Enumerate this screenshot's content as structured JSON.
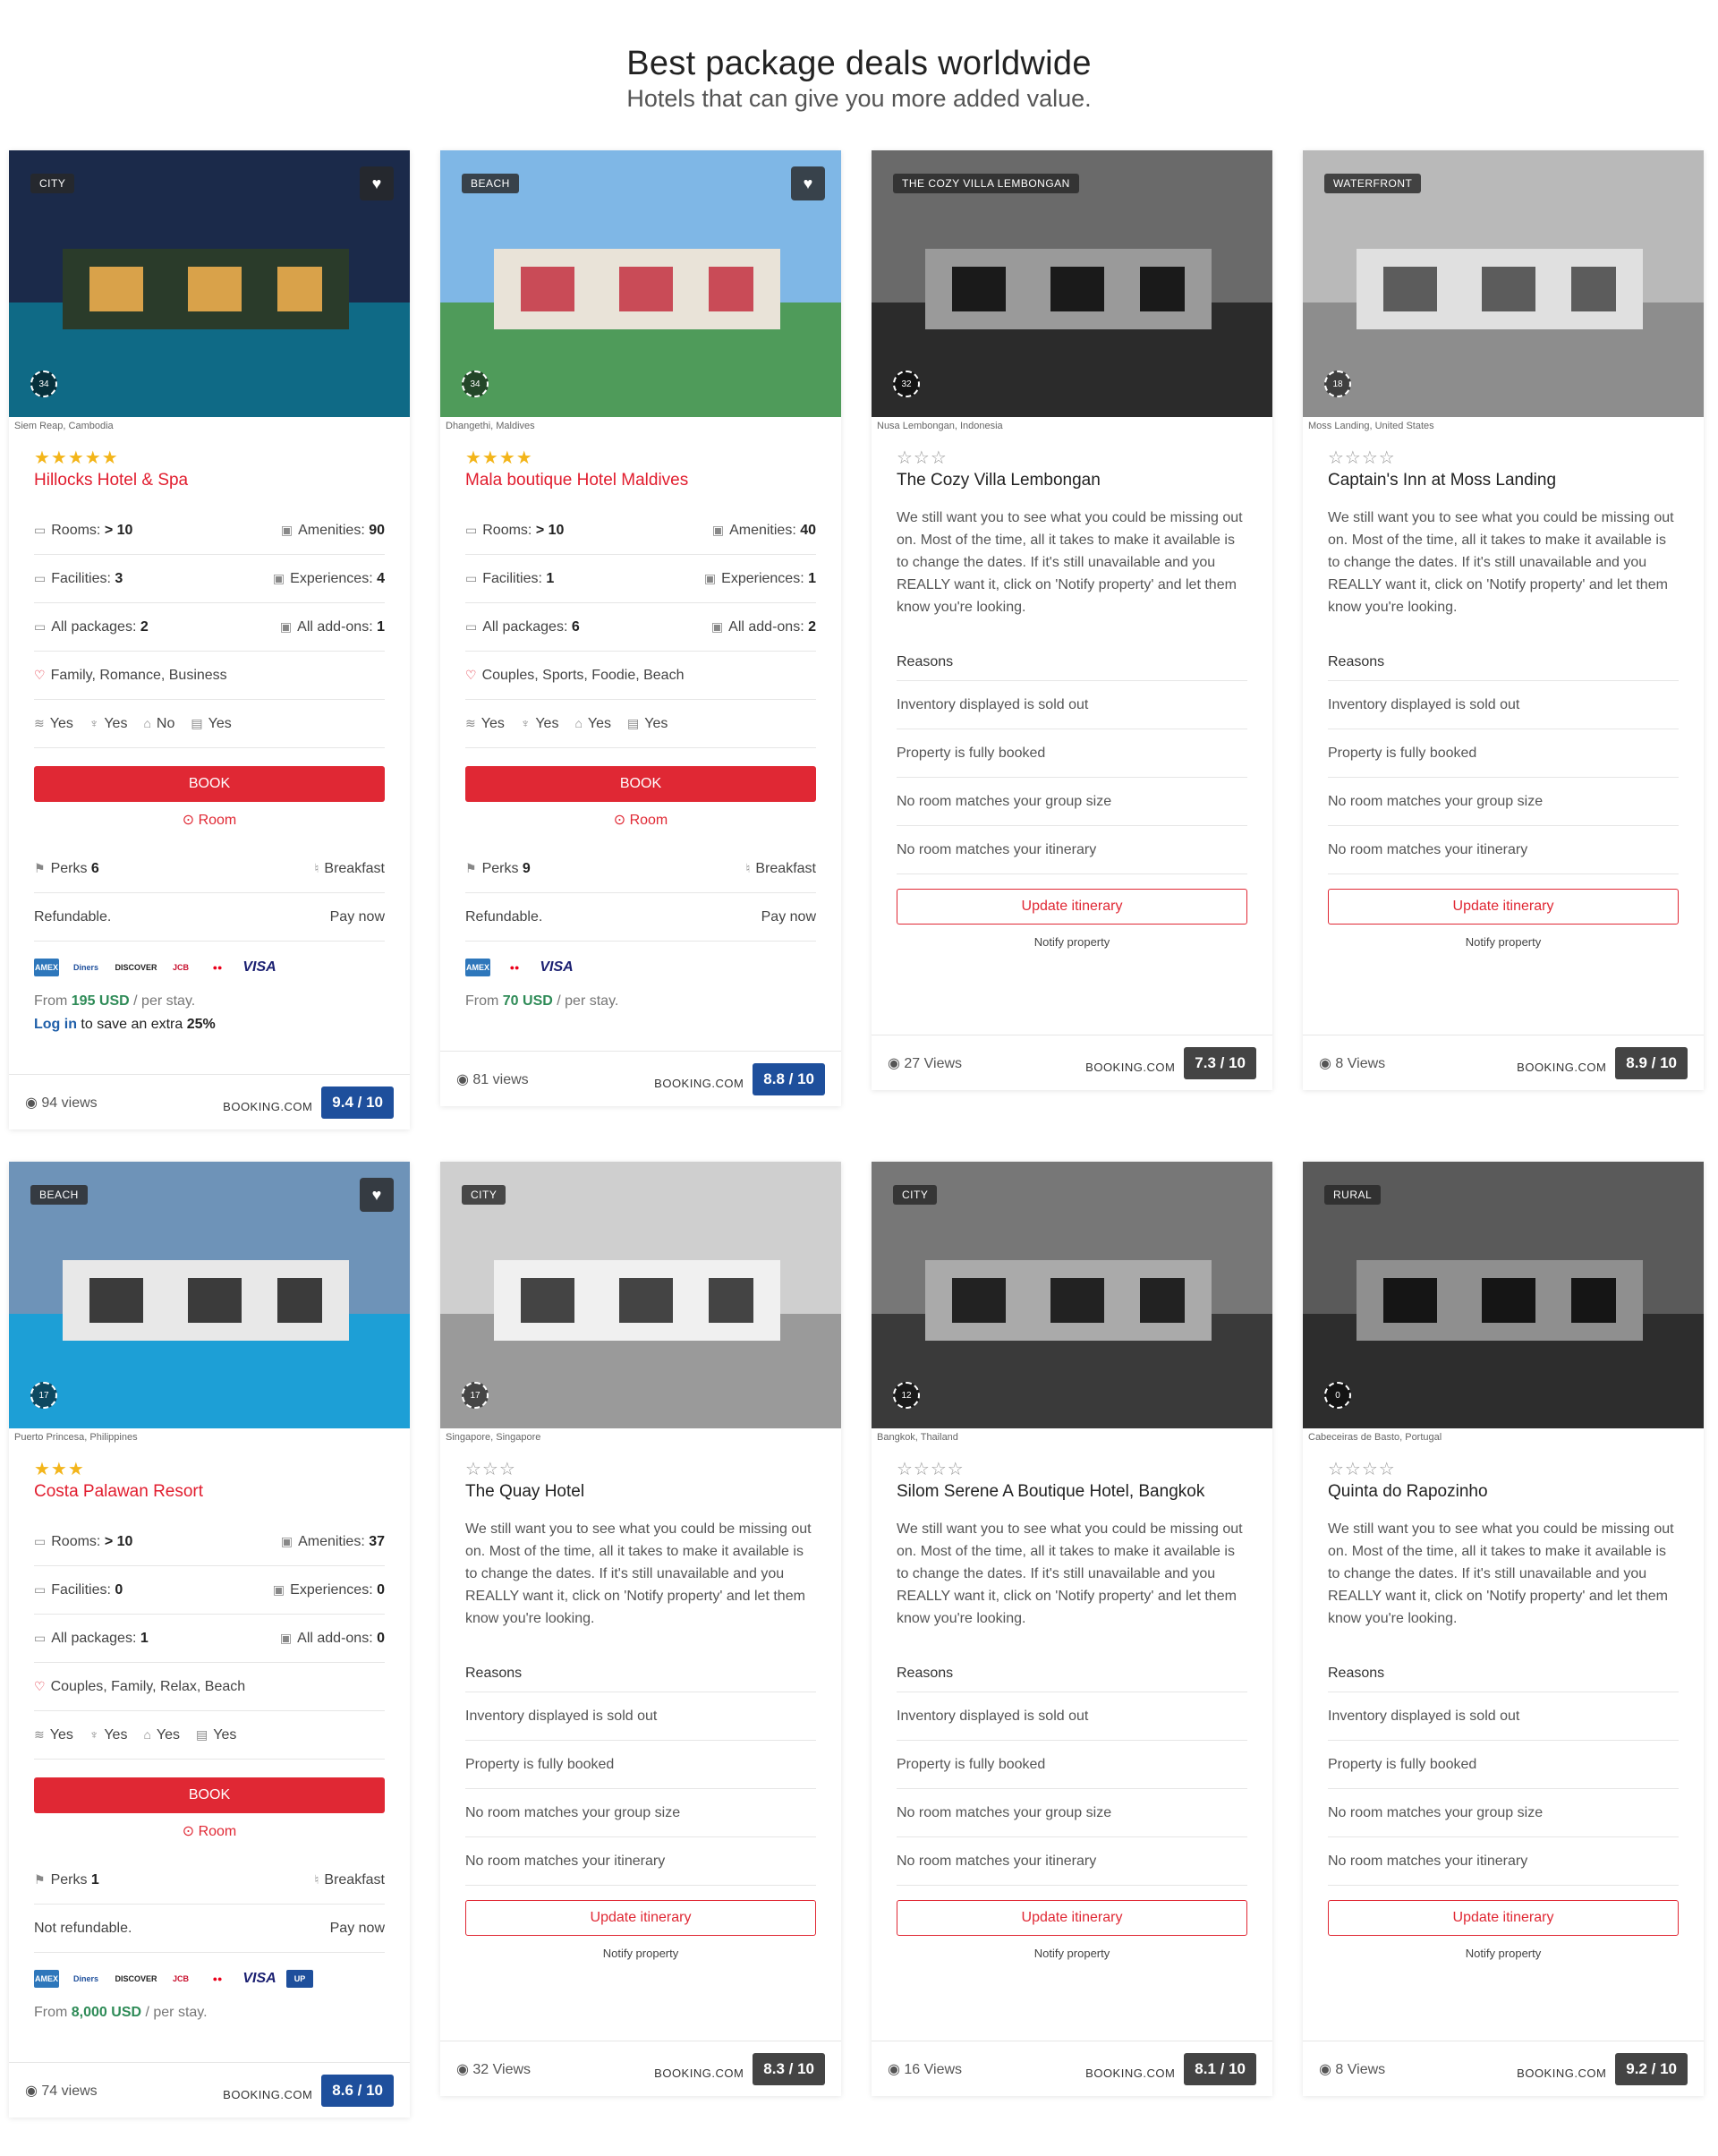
{
  "header": {
    "title": "Best package deals worldwide",
    "subtitle": "Hotels that can give you more added value."
  },
  "colors": {
    "accent_red": "#e02834",
    "score_blue": "#1e4f9c",
    "score_grey": "#444444",
    "star_gold": "#f3b51a"
  },
  "labels": {
    "book": "BOOK",
    "room": "Room",
    "reasons": "Reasons",
    "update": "Update itinerary",
    "notify": "Notify property",
    "booking": "BOOKING.COM",
    "rooms": "Rooms:",
    "amenities": "Amenities:",
    "facilities": "Facilities:",
    "experiences": "Experiences:",
    "packages": "All packages:",
    "addons": "All add-ons:",
    "perks": "Perks",
    "breakfast": "Breakfast",
    "pay_now": "Pay now",
    "from": "From",
    "per_stay": "/ per stay.",
    "login": "Log in",
    "login_rest": "to save an extra",
    "login_pct": "25%",
    "desc": "We still want you to see what you could be missing out on. Most of the time, all it takes to make it available is to change the dates. If it's still unavailable and you REALLY want it, click on 'Notify property' and let them know you're looking.",
    "reason_list": [
      "Inventory displayed is sold out",
      "Property is fully booked",
      "No room matches your group size",
      "No room matches your itinerary"
    ]
  },
  "cards": [
    {
      "type": "available",
      "tag": "CITY",
      "count360": "34",
      "location": "Siem Reap, Cambodia",
      "stars": "★★★★★",
      "name": "Hillocks Hotel & Spa",
      "rooms": "> 10",
      "amenities": "90",
      "facilities": "3",
      "experiences": "4",
      "packages": "2",
      "addons": "1",
      "themes": "Family, Romance, Business",
      "wifi": [
        "Yes",
        "Yes",
        "No",
        "Yes"
      ],
      "perks": "6",
      "refund": "Refundable.",
      "payment_icons": [
        "amex-icon",
        "diners-icon",
        "discover-icon",
        "jcb-icon",
        "mastercard-icon",
        "visa-icon"
      ],
      "price": "195 USD",
      "show_login": true,
      "views": "94 views",
      "score": "9.4 / 10"
    },
    {
      "type": "available",
      "tag": "BEACH",
      "count360": "34",
      "location": "Dhangethi, Maldives",
      "stars": "★★★★",
      "name": "Mala boutique Hotel Maldives",
      "rooms": "> 10",
      "amenities": "40",
      "facilities": "1",
      "experiences": "1",
      "packages": "6",
      "addons": "2",
      "themes": "Couples, Sports, Foodie, Beach",
      "wifi": [
        "Yes",
        "Yes",
        "Yes",
        "Yes"
      ],
      "perks": "9",
      "refund": "Refundable.",
      "payment_icons": [
        "amex-icon",
        "mastercard-icon",
        "visa-icon"
      ],
      "price": "70 USD",
      "show_login": false,
      "views": "81 views",
      "score": "8.8 / 10"
    },
    {
      "type": "unavailable",
      "tag": "THE COZY VILLA LEMBONGAN",
      "count360": "32",
      "location": "Nusa Lembongan, Indonesia",
      "stars": "☆☆☆",
      "name": "The Cozy Villa Lembongan",
      "views": "27 Views",
      "score": "7.3 / 10"
    },
    {
      "type": "unavailable",
      "tag": "WATERFRONT",
      "count360": "18",
      "location": "Moss Landing, United States",
      "stars": "☆☆☆☆",
      "name": "Captain's Inn at Moss Landing",
      "views": "8 Views",
      "score": "8.9 / 10"
    },
    {
      "type": "available",
      "tag": "BEACH",
      "count360": "17",
      "location": "Puerto Princesa, Philippines",
      "stars": "★★★",
      "name": "Costa Palawan Resort",
      "rooms": "> 10",
      "amenities": "37",
      "facilities": "0",
      "experiences": "0",
      "packages": "1",
      "addons": "0",
      "themes": "Couples, Family, Relax, Beach",
      "wifi": [
        "Yes",
        "Yes",
        "Yes",
        "Yes"
      ],
      "perks": "1",
      "refund": "Not refundable.",
      "payment_icons": [
        "amex-icon",
        "diners-icon",
        "discover-icon",
        "jcb-icon",
        "mastercard-icon",
        "visa-icon",
        "unionpay-icon"
      ],
      "price": "8,000 USD",
      "show_login": false,
      "views": "74 views",
      "score": "8.6 / 10"
    },
    {
      "type": "unavailable",
      "tag": "CITY",
      "count360": "17",
      "location": "Singapore, Singapore",
      "stars": "☆☆☆",
      "name": "The Quay Hotel",
      "views": "32 Views",
      "score": "8.3 / 10"
    },
    {
      "type": "unavailable",
      "tag": "CITY",
      "count360": "12",
      "location": "Bangkok, Thailand",
      "stars": "☆☆☆☆",
      "name": "Silom Serene A Boutique Hotel, Bangkok",
      "views": "16 Views",
      "score": "8.1 / 10"
    },
    {
      "type": "unavailable",
      "tag": "RURAL",
      "count360": "0",
      "location": "Cabeceiras de Basto, Portugal",
      "stars": "☆☆☆☆",
      "name": "Quinta do Rapozinho",
      "views": "8 Views",
      "score": "9.2 / 10"
    }
  ]
}
